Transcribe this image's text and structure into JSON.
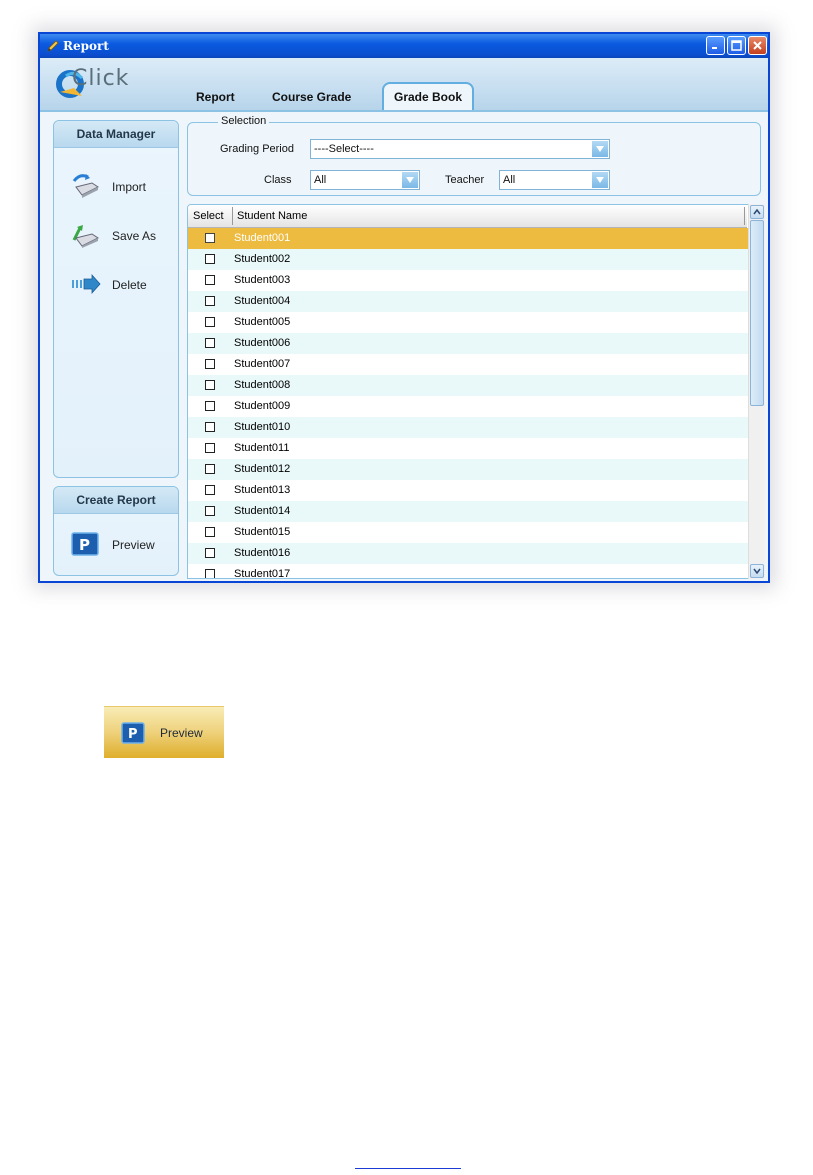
{
  "window": {
    "title": "Report",
    "logo_text": "Click"
  },
  "tabs": [
    {
      "label": "Report",
      "active": false
    },
    {
      "label": "Course Grade",
      "active": false
    },
    {
      "label": "Grade Book",
      "active": true
    }
  ],
  "data_manager": {
    "title": "Data Manager",
    "items": [
      {
        "label": "Import",
        "icon": "import-icon"
      },
      {
        "label": "Save As",
        "icon": "save-as-icon"
      },
      {
        "label": "Delete",
        "icon": "delete-arrow-icon"
      }
    ]
  },
  "create_report": {
    "title": "Create Report",
    "preview_label": "Preview"
  },
  "selection": {
    "legend": "Selection",
    "grading_period_label": "Grading Period",
    "grading_period_value": "----Select----",
    "class_label": "Class",
    "class_value": "All",
    "teacher_label": "Teacher",
    "teacher_value": "All"
  },
  "grid": {
    "columns": [
      "Select",
      "Student Name"
    ],
    "rows": [
      "Student001",
      "Student002",
      "Student003",
      "Student004",
      "Student005",
      "Student006",
      "Student007",
      "Student008",
      "Student009",
      "Student010",
      "Student011",
      "Student012",
      "Student013",
      "Student014",
      "Student015",
      "Student016",
      "Student017"
    ],
    "selected_index": 0
  },
  "preview_callout": {
    "label": "Preview"
  },
  "colors": {
    "title_bar": "#0a4fd0",
    "selected_row": "#ecbb3f",
    "alt_row": "#e9f8f8",
    "panel_border": "#8cc2e3"
  }
}
